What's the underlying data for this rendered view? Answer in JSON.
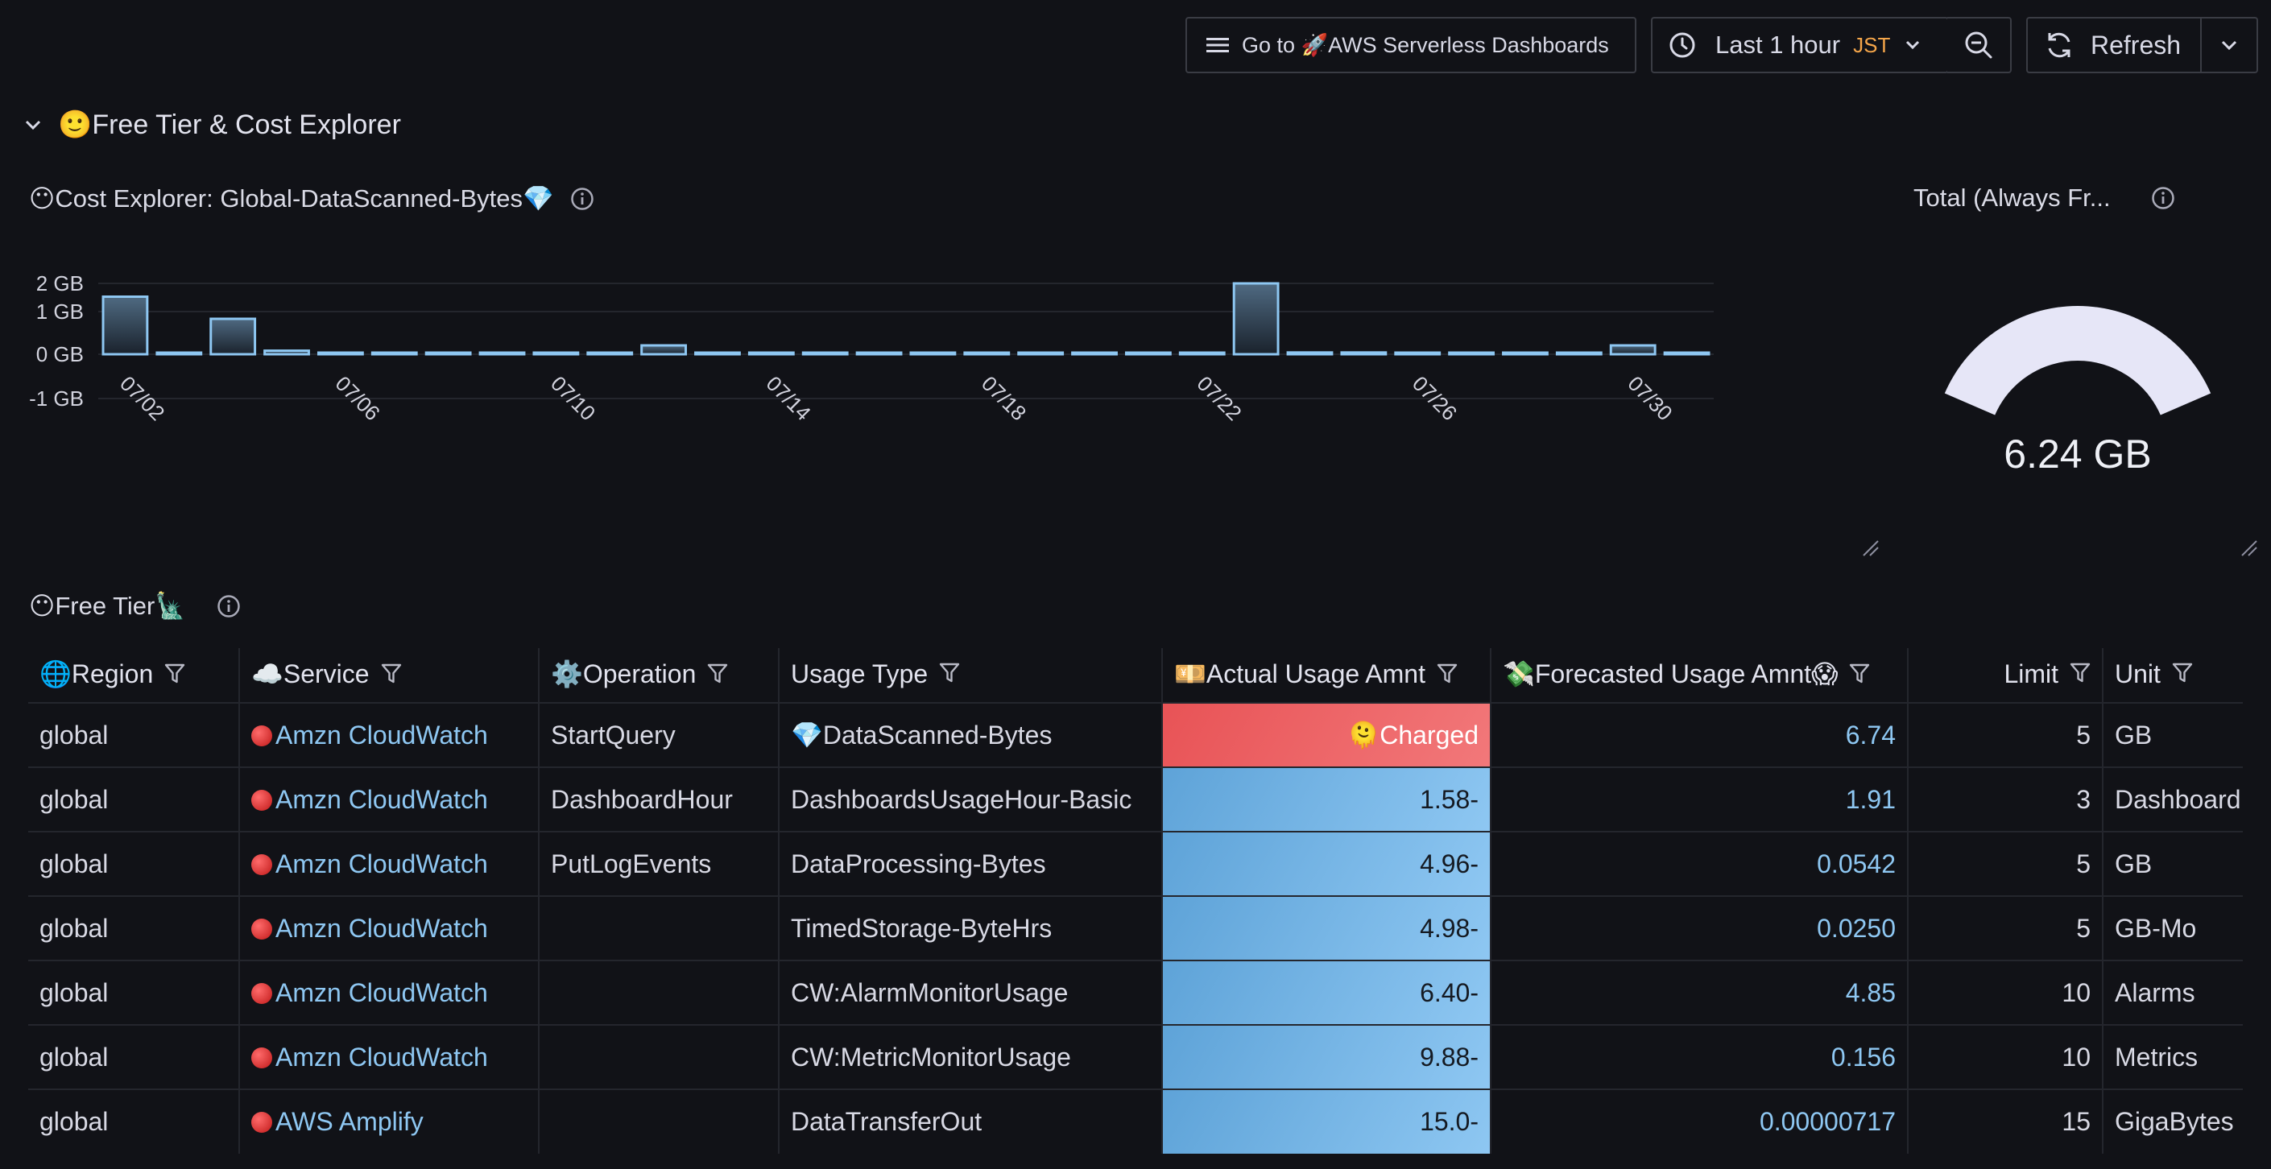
{
  "toolbar": {
    "goto_label": "Go to 🚀AWS Serverless Dashboards",
    "time_range_label": "Last 1 hour",
    "timezone": "JST",
    "refresh_label": "Refresh"
  },
  "row": {
    "title": "🙂Free Tier & Cost Explorer"
  },
  "cost_panel": {
    "title": "😶Cost Explorer: Global-DataScanned-Bytes💎"
  },
  "gauge_panel": {
    "title": "Total (Always Fr...",
    "value": "6.24 GB",
    "fill_fraction": 1
  },
  "free_tier_panel": {
    "title": "😶Free Tier🗽"
  },
  "colors": {
    "background": "#111217",
    "bar_stroke": "#8ec7f2",
    "gauge": "#e6e6f7",
    "charged": "#e85356",
    "cell_blue": "#7ab8e6",
    "link": "#8ec7f2",
    "accent": "#f5a64a"
  },
  "chart_data": {
    "type": "bar",
    "title": "😶Cost Explorer: Global-DataScanned-Bytes💎",
    "y_ticks": [
      "2 GB",
      "1 GB",
      "0 GB",
      "-1 GB"
    ],
    "x_ticks": [
      "07/02",
      "07/06",
      "07/10",
      "07/14",
      "07/18",
      "07/22",
      "07/26",
      "07/30"
    ],
    "ylim": [
      -1,
      2
    ],
    "unit": "GB",
    "categories": [
      "07/02",
      "07/03",
      "07/04",
      "07/05",
      "07/06",
      "07/07",
      "07/08",
      "07/09",
      "07/10",
      "07/11",
      "07/12",
      "07/13",
      "07/14",
      "07/15",
      "07/16",
      "07/17",
      "07/18",
      "07/19",
      "07/20",
      "07/21",
      "07/22",
      "07/23",
      "07/24",
      "07/25",
      "07/26",
      "07/27",
      "07/28",
      "07/29",
      "07/30",
      "07/31"
    ],
    "values": [
      1.3,
      0,
      0.8,
      0.08,
      0,
      0,
      0,
      0,
      0,
      0,
      0.2,
      0.03,
      0,
      0,
      0,
      0,
      0,
      0,
      0,
      0,
      0,
      1.6,
      0.04,
      0.04,
      0,
      0,
      0,
      0,
      0.2,
      0
    ],
    "grid": true
  },
  "table": {
    "columns": [
      {
        "label": "🌐Region",
        "align": "left"
      },
      {
        "label": "☁️Service",
        "align": "left"
      },
      {
        "label": "⚙️Operation",
        "align": "left"
      },
      {
        "label": "Usage Type",
        "align": "left"
      },
      {
        "label": "💴Actual Usage Amnt",
        "align": "left"
      },
      {
        "label": "💸Forecasted Usage Amnt😱",
        "align": "left"
      },
      {
        "label": "Limit",
        "align": "right"
      },
      {
        "label": "Unit",
        "align": "left"
      }
    ],
    "rows": [
      {
        "region": "global",
        "service": "Amzn CloudWatch",
        "operation": "StartQuery",
        "usage_type": "💎DataScanned-Bytes",
        "actual": "🫠Charged",
        "actual_status": "charged",
        "forecast": "6.74",
        "limit": "5",
        "unit": "GB"
      },
      {
        "region": "global",
        "service": "Amzn CloudWatch",
        "operation": "DashboardHour",
        "usage_type": "DashboardsUsageHour-Basic",
        "actual": "1.58-",
        "actual_status": "ok",
        "forecast": "1.91",
        "limit": "3",
        "unit": "Dashboard"
      },
      {
        "region": "global",
        "service": "Amzn CloudWatch",
        "operation": "PutLogEvents",
        "usage_type": "DataProcessing-Bytes",
        "actual": "4.96-",
        "actual_status": "ok",
        "forecast": "0.0542",
        "limit": "5",
        "unit": "GB"
      },
      {
        "region": "global",
        "service": "Amzn CloudWatch",
        "operation": "",
        "usage_type": "TimedStorage-ByteHrs",
        "actual": "4.98-",
        "actual_status": "ok",
        "forecast": "0.0250",
        "limit": "5",
        "unit": "GB-Mo"
      },
      {
        "region": "global",
        "service": "Amzn CloudWatch",
        "operation": "",
        "usage_type": "CW:AlarmMonitorUsage",
        "actual": "6.40-",
        "actual_status": "ok",
        "forecast": "4.85",
        "limit": "10",
        "unit": "Alarms"
      },
      {
        "region": "global",
        "service": "Amzn CloudWatch",
        "operation": "",
        "usage_type": "CW:MetricMonitorUsage",
        "actual": "9.88-",
        "actual_status": "ok",
        "forecast": "0.156",
        "limit": "10",
        "unit": "Metrics"
      },
      {
        "region": "global",
        "service": "AWS Amplify",
        "operation": "",
        "usage_type": "DataTransferOut",
        "actual": "15.0-",
        "actual_status": "ok",
        "forecast": "0.00000717",
        "limit": "15",
        "unit": "GigaBytes"
      }
    ]
  }
}
